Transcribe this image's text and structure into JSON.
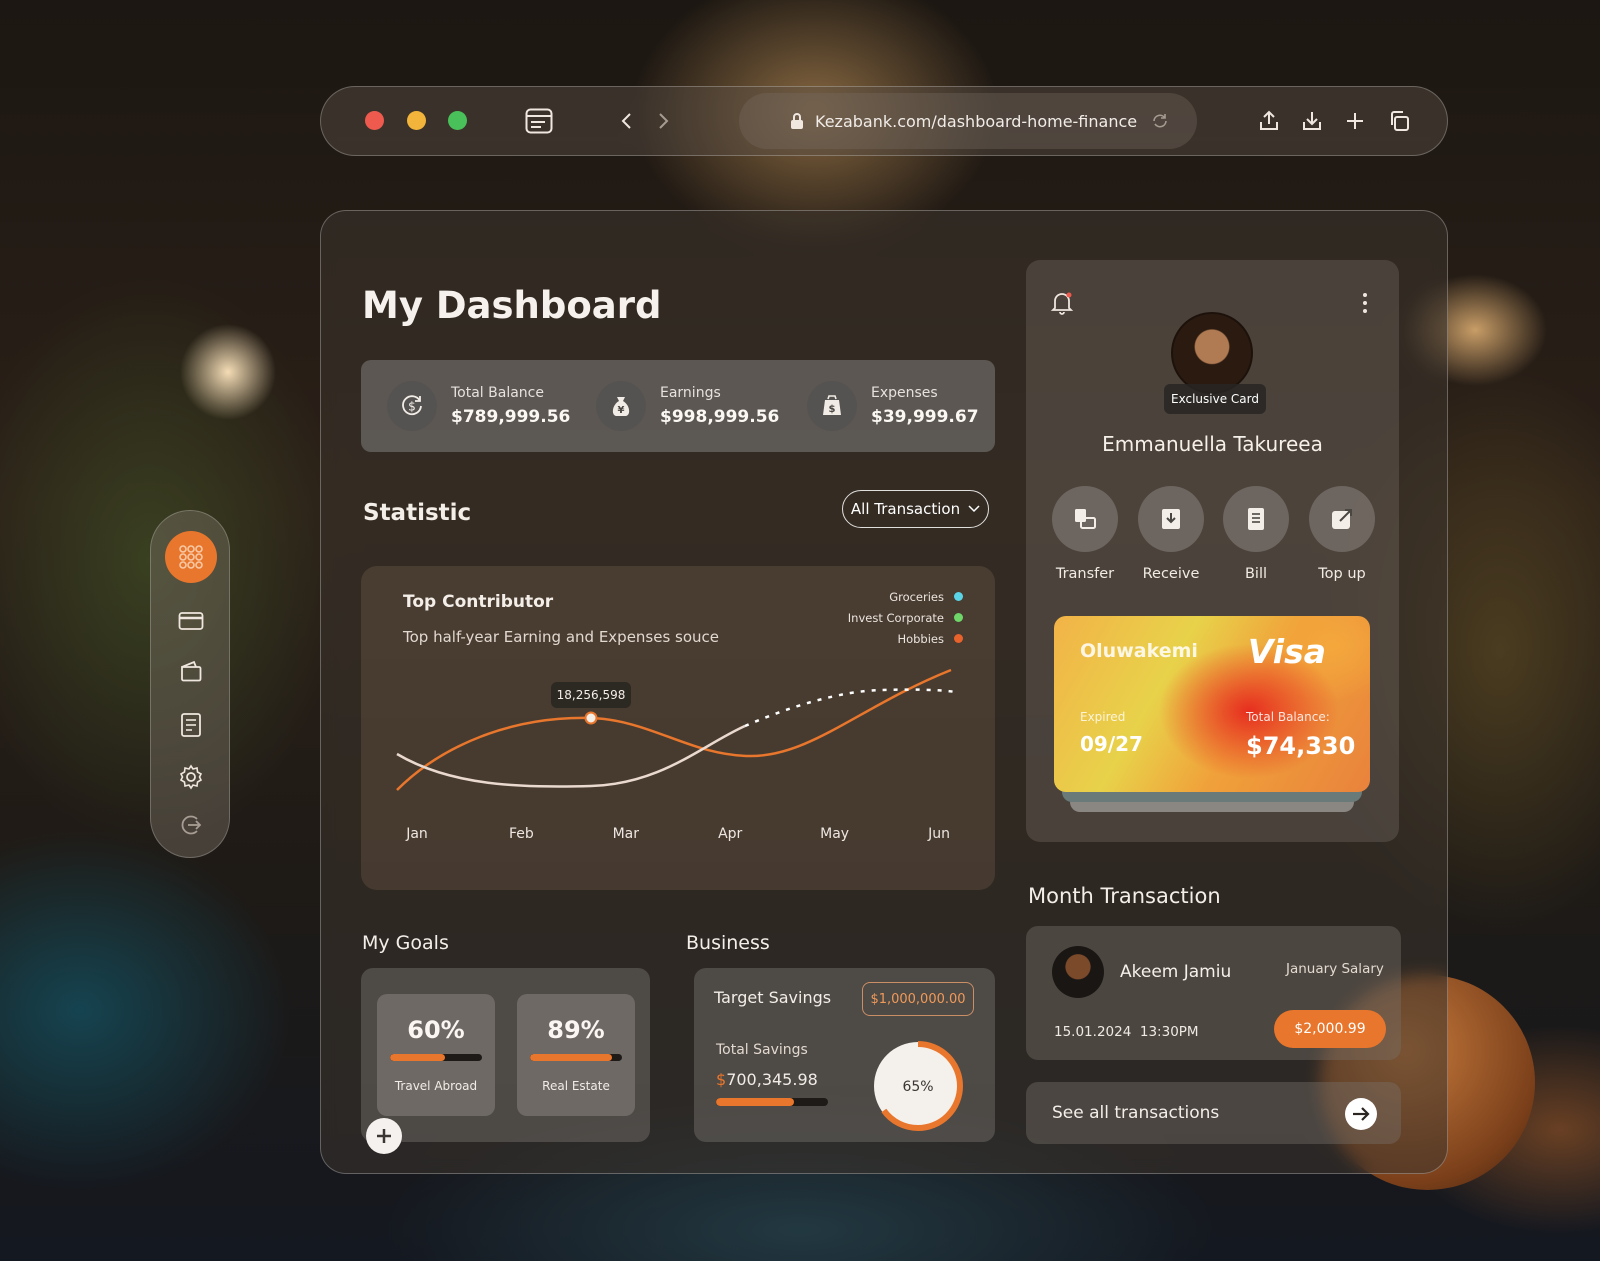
{
  "browser": {
    "url": "Kezabank.com/dashboard-home-finance"
  },
  "page": {
    "title": "My Dashboard"
  },
  "summary": [
    {
      "label": "Total Balance",
      "value": "$789,999.56",
      "icon": "dollar-cycle-icon"
    },
    {
      "label": "Earnings",
      "value": "$998,999.56",
      "icon": "yen-bag-icon"
    },
    {
      "label": "Expenses",
      "value": "$39,999.67",
      "icon": "dollar-bag-icon"
    }
  ],
  "statistic": {
    "heading": "Statistic",
    "filter_label": "All Transaction",
    "card_title": "Top Contributor",
    "card_subtitle": "Top half-year Earning and Expenses souce",
    "tooltip": "18,256,598"
  },
  "chart_data": {
    "type": "line",
    "categories": [
      "Jan",
      "Feb",
      "Mar",
      "Apr",
      "May",
      "Jun"
    ],
    "legend": [
      "Groceries",
      "Invest Corporate",
      "Hobbies"
    ],
    "legend_colors": [
      "#5ad4e6",
      "#6fd66a",
      "#e8622c"
    ],
    "legend_position": "top-right",
    "highlight": {
      "category": "Feb",
      "label": "18,256,598"
    },
    "grid": false
  },
  "goals": {
    "heading": "My Goals",
    "items": [
      {
        "percent": "60%",
        "label": "Travel Abroad",
        "fill": 0.6
      },
      {
        "percent": "89%",
        "label": "Real Estate",
        "fill": 0.89
      }
    ]
  },
  "business": {
    "heading": "Business",
    "target_label": "Target Savings",
    "target_value": "$1,000,000.00",
    "total_label": "Total Savings",
    "total_prefix": "$",
    "total_value": "700,345.98",
    "progress": 0.7,
    "ring_percent": "65%",
    "ring_fraction": 0.65
  },
  "profile": {
    "badge": "Exclusive Card",
    "name": "Emmanuella Takureea",
    "actions": [
      {
        "label": "Transfer",
        "icon": "transfer-icon"
      },
      {
        "label": "Receive",
        "icon": "receive-icon"
      },
      {
        "label": "Bill",
        "icon": "bill-icon"
      },
      {
        "label": "Top up",
        "icon": "top-up-icon"
      }
    ]
  },
  "card": {
    "holder": "Oluwakemi",
    "brand": "Visa",
    "expired_label": "Expired",
    "expiry": "09/27",
    "balance_label": "Total Balance:",
    "balance": "$74,330"
  },
  "month_transaction": {
    "heading": "Month Transaction",
    "name": "Akeem Jamiu",
    "type": "January Salary",
    "datetime": "15.01.2024  13:30PM",
    "amount": "$2,000.99",
    "see_all": "See all transactions"
  },
  "colors": {
    "accent": "#e8762c",
    "panel": "#3c342e"
  }
}
